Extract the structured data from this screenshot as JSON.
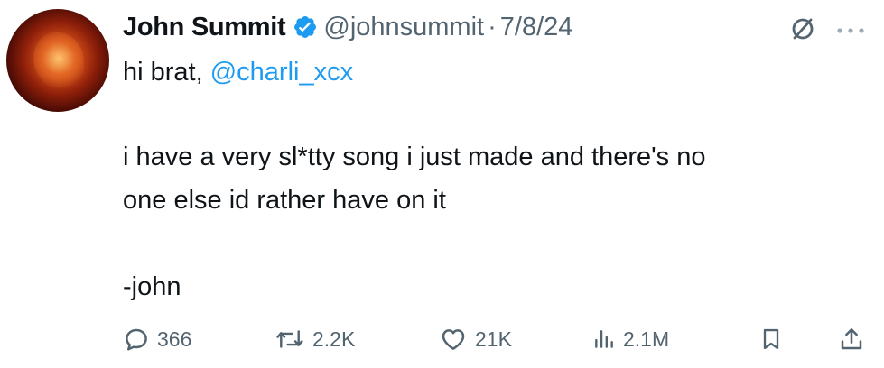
{
  "tweet": {
    "author_name": "John Summit",
    "author_handle": "@johnsummit",
    "separator": "·",
    "date": "7/8/24",
    "greeting": "hi brat,",
    "mention": "@charli_xcx",
    "body_lines": [
      "i have a very sl*tty song i just made and there's no",
      "one else id rather have on it"
    ],
    "signoff": "-john"
  },
  "actions": {
    "replies": "366",
    "reposts": "2.2K",
    "likes": "21K",
    "views": "2.1M"
  },
  "icons": {
    "verified": "verified-badge-icon",
    "grok": "grok-icon",
    "more": "more-icon",
    "reply": "reply-icon",
    "repost": "repost-icon",
    "like": "heart-icon",
    "views": "views-icon",
    "bookmark": "bookmark-icon",
    "share": "share-icon"
  },
  "colors": {
    "text": "#0f1419",
    "secondary": "#536471",
    "accent": "#1d9bf0"
  }
}
